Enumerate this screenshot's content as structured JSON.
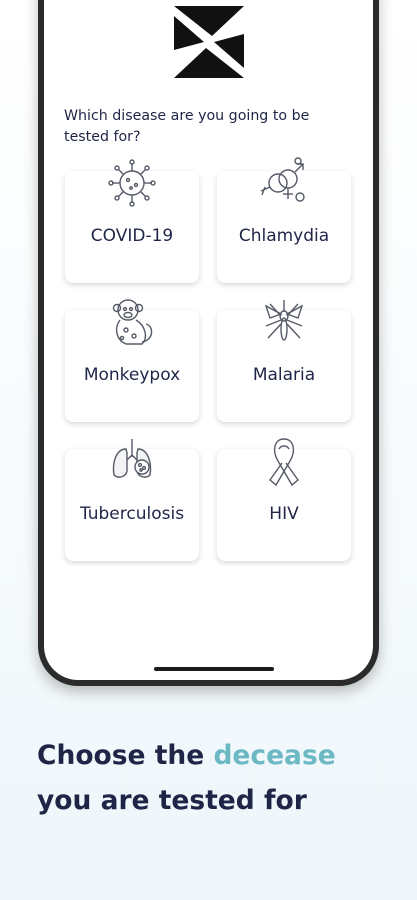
{
  "question": "Which disease are you going to be tested for?",
  "diseases": [
    {
      "label": "COVID-19",
      "icon": "virus-icon"
    },
    {
      "label": "Chlamydia",
      "icon": "gender-symbols-icon"
    },
    {
      "label": "Monkeypox",
      "icon": "monkey-icon"
    },
    {
      "label": "Malaria",
      "icon": "mosquito-icon"
    },
    {
      "label": "Tuberculosis",
      "icon": "lungs-icon"
    },
    {
      "label": "HIV",
      "icon": "awareness-ribbon-icon"
    }
  ],
  "caption": {
    "line1_prefix": "Choose the ",
    "line1_accent": "decease",
    "line2": "you are tested for"
  },
  "colors": {
    "text": "#1f2547",
    "accent": "#6cb9c4",
    "frame": "#2b2b2b"
  }
}
